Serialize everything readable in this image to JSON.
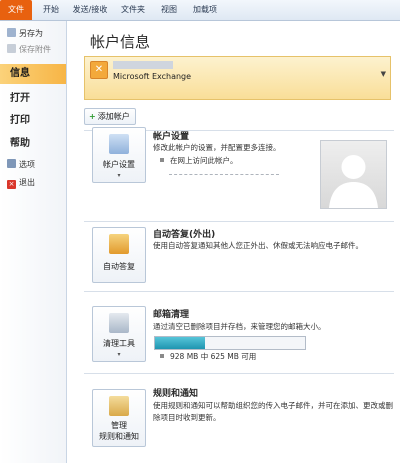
{
  "ribbon": {
    "tabs": [
      {
        "label": "文件"
      },
      {
        "label": "开始"
      },
      {
        "label": "发送/接收"
      },
      {
        "label": "文件夹"
      },
      {
        "label": "视图"
      },
      {
        "label": "加载项"
      }
    ]
  },
  "nav": {
    "save_as": "另存为",
    "save_attachments": "保存附件",
    "info": "信息",
    "open": "打开",
    "print": "打印",
    "help": "帮助",
    "options": "选项",
    "exit": "退出"
  },
  "main": {
    "title": "帐户信息",
    "account": {
      "name": "Microsoft Exchange"
    },
    "add_account": "添加帐户",
    "account_settings": {
      "button": "帐户设置",
      "title": "帐户设置",
      "description": "修改此帐户的设置，并配置更多连接。",
      "bullet": "在网上访问此帐户。"
    },
    "auto_reply": {
      "button": "自动答复",
      "title": "自动答复(外出)",
      "description": "使用自动答复通知其他人您正外出、休假或无法响应电子邮件。"
    },
    "cleanup": {
      "button": "清理工具",
      "title": "邮箱清理",
      "description": "通过清空已删除项目并存档，来管理您的邮箱大小。",
      "storage_text": "928 MB 中 625 MB 可用",
      "storage_used_fraction": 0.33
    },
    "rules": {
      "button_line1": "管理",
      "button_line2": "规则和通知",
      "title": "规则和通知",
      "description": "使用规则和通知可以帮助组织您的传入电子邮件，并可在添加、更改或删除项目时收到更新。"
    }
  },
  "colors": {
    "file_tab": "#e8610f",
    "selected_nav": "#f7b546",
    "storage_bar": "#1f95b0"
  }
}
